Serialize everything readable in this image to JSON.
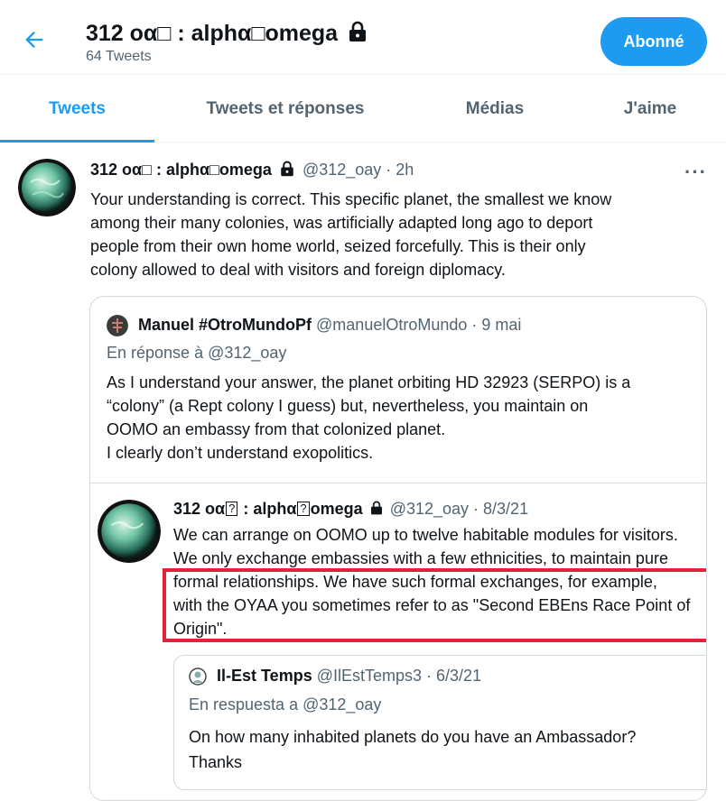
{
  "header": {
    "title": "312 οα□ : alphα□omega",
    "tweet_count": "64 Tweets",
    "follow_label": "Abonné"
  },
  "tabs": [
    {
      "label": "Tweets",
      "active": true
    },
    {
      "label": "Tweets et réponses",
      "active": false
    },
    {
      "label": "Médias",
      "active": false
    },
    {
      "label": "J'aime",
      "active": false
    }
  ],
  "tweet": {
    "display_name": "312 οα□ : alphα□omega",
    "handle_time": "@312_oay · 2h",
    "more": "···",
    "body_lines": [
      "Your understanding is correct. This specific planet, the smallest we know",
      "among their many colonies, was artificially adapted long ago to deport",
      "people from their own home world, seized forcefully. This is their only",
      "colony allowed to deal with visitors and foreign diplomacy."
    ]
  },
  "quote": {
    "display_name": "Manuel #OtroMundoPf",
    "handle_time": "@manuelOtroMundo · 9 mai",
    "reply_to": "En réponse à @312_oay",
    "body_lines": [
      "As I understand your answer, the planet orbiting HD 32923 (SERPO) is a",
      "“colony” (a Rept colony I guess) but, nevertheless, you maintain on",
      "OOMO an embassy from that colonized planet.",
      "I clearly don’t understand exopolitics."
    ]
  },
  "screenshot": {
    "name_part1": "312 οα",
    "name_part2": " : alphα",
    "name_part3": "omega",
    "qbox": "?",
    "handle_time": "@312_oay · 8/3/21",
    "body_lines": [
      "We can arrange on OOMO up to twelve habitable modules for visitors.",
      "We only exchange embassies with a few ethnicities, to maintain pure",
      "formal relationships. We have such formal exchanges, for example,",
      "with the OYAA you sometimes refer to as \"Second EBEns Race Point of",
      "Origin\"."
    ],
    "nested": {
      "display_name": "Il-Est Temps",
      "handle_time": "@IlEstTemps3 · 6/3/21",
      "reply_to": "En respuesta a @312_oay",
      "body_lines": [
        "On how many inhabited planets do you have an Ambassador?",
        "Thanks"
      ]
    }
  },
  "colors": {
    "accent": "#1d9bf0",
    "highlight": "#e0233a",
    "text": "#0f1419",
    "muted": "#536471"
  }
}
